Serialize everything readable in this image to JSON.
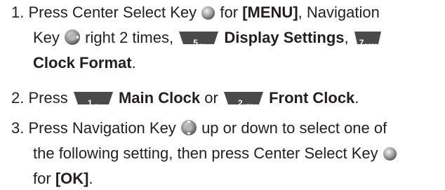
{
  "steps": [
    {
      "number": "1.",
      "press": "Press Center Select Key",
      "for": "for",
      "menu": "[MENU]",
      "nav_comma": ", Navigation",
      "key_word": "Key",
      "right_times": "right 2 times,",
      "display_settings": "Display Settings",
      "comma": ",",
      "clock_format": "Clock Format",
      "period": "."
    },
    {
      "number": "2.",
      "press": "Press",
      "main_clock": "Main Clock",
      "or": "or",
      "front_clock": "Front Clock",
      "period": "."
    },
    {
      "number": "3.",
      "text_a": "Press Navigation Key",
      "text_b": "up or down to select one of",
      "text_c": "the following setting, then press Center Select Key",
      "text_d": "for",
      "ok": "[OK]",
      "period": "."
    }
  ],
  "keys": {
    "five": {
      "main": "5",
      "sub": "JKL"
    },
    "seven": {
      "main": "7",
      "sub": "PQRS"
    },
    "one": {
      "main": "1",
      "sub": "@"
    },
    "two": {
      "main": "2",
      "sub": "ABC"
    }
  },
  "icons": {
    "center_select": "center-select-key-icon",
    "nav_right": "navigation-key-right-icon",
    "nav_updown": "navigation-key-up-down-icon"
  }
}
